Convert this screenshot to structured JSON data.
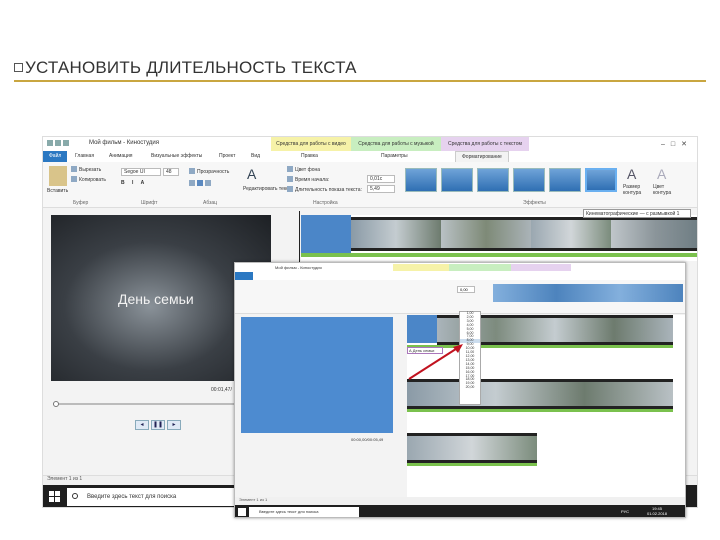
{
  "slide": {
    "heading": "УСТАНОВИТЬ ДЛИТЕЛЬНОСТЬ ТЕКСТА"
  },
  "app": {
    "title": "Мой фильм - Киностудия",
    "context_tabs": [
      "Средства для работы с видео",
      "Средства для работы с музыкой",
      "Средства для работы с текстом"
    ],
    "tabs": [
      "Файл",
      "Главная",
      "Анимация",
      "Визуальные эффекты",
      "Проект",
      "Вид",
      "Правка",
      "Параметры",
      "Форматирование"
    ],
    "clipboard": {
      "paste": "Вставить",
      "cut": "Вырезать",
      "copy": "Копировать",
      "group": "Буфер"
    },
    "font": {
      "family": "Segoe UI",
      "size": "48",
      "group": "Шрифт"
    },
    "paragraph": {
      "transparency": "Прозрачность",
      "group": "Абзац"
    },
    "settings": {
      "edit_text": "Редактировать текст",
      "bg_color": "Цвет фона",
      "start_time": "Время начала:",
      "start_time_value": "0,01с",
      "duration": "Длительность показа текста:",
      "duration_value": "5,49",
      "group": "Настройка"
    },
    "effects": {
      "group": "Эффекты",
      "outline_size": "Размер контура",
      "outline_color": "Цвет контура",
      "tooltip": "Кинематографические — с размывкой 1"
    },
    "preview_text": "День семьи",
    "timecode": "00:01,47/",
    "status": "Элемент 1 из 1",
    "taskbar_search": "Введите здесь текст для поиска"
  },
  "inset": {
    "title": "Мой фильм - Киностудия",
    "duration_value": "0,00",
    "dropdown_values": [
      "1,00",
      "2,00",
      "3,00",
      "4,00",
      "5,00",
      "6,00",
      "7,00",
      "8,00",
      "9,00",
      "10,00",
      "11,00",
      "12,00",
      "13,00",
      "14,00",
      "15,00",
      "16,00",
      "17,00",
      "18,00",
      "19,00",
      "20,00"
    ],
    "text_label": "А День семьи",
    "timecode": "00:00,00/00:05,49",
    "status": "Элемент 1 из 1",
    "taskbar_search": "Введите здесь текст для поиска",
    "lang": "РУС",
    "time": "19:45",
    "date": "01.02.2018"
  }
}
